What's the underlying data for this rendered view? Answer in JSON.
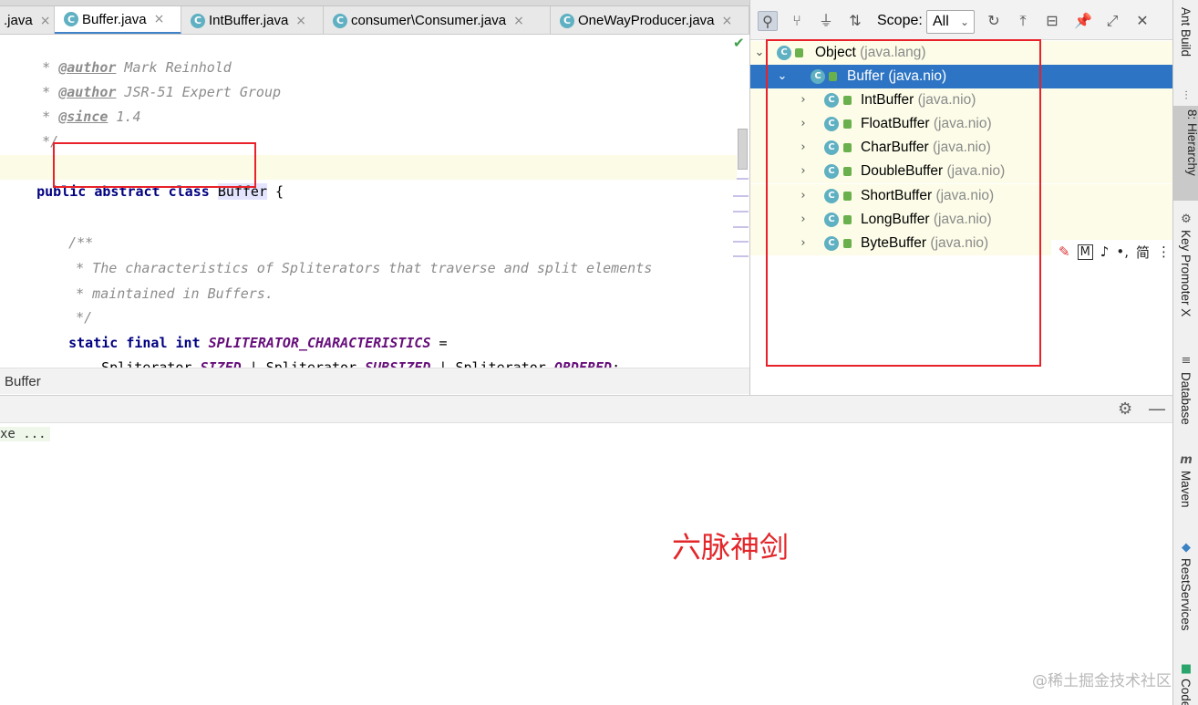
{
  "tabs": [
    {
      "label": ".java",
      "icon": "",
      "active": false
    },
    {
      "label": "Buffer.java",
      "icon": "c-abstract-class-icon",
      "active": true
    },
    {
      "label": "IntBuffer.java",
      "icon": "c-abstract-class-icon",
      "active": false
    },
    {
      "label": "consumer\\Consumer.java",
      "icon": "c-class-icon",
      "active": false
    },
    {
      "label": "OneWayProducer.java",
      "icon": "c-class-icon",
      "active": false
    }
  ],
  "tab_close_glyph": "×",
  "editor": {
    "lines": {
      "l1_star": "* ",
      "l1_tag": "@author",
      "l1_text": " Mark Reinhold",
      "l2_star": "* ",
      "l2_tag": "@author",
      "l2_text": " JSR-51 Expert Group",
      "l3_star": "* ",
      "l3_tag": "@since",
      "l3_text": " 1.4",
      "l4": "*/",
      "l5_public": "public ",
      "l5_abstract": "abstract class ",
      "l5_name": "Buffer",
      "l5_brace": " {",
      "l6": "/**",
      "l7": "* The characteristics of Spliterators that traverse and split elements",
      "l8": "* maintained in Buffers.",
      "l9": "*/",
      "l10_kw": "static final int ",
      "l10_const": "SPLITERATOR_CHARACTERISTICS",
      "l10_eq": " =",
      "l11_a": "Spliterator.",
      "l11_b": "SIZED",
      "l11_c": " | Spliterator.",
      "l11_d": "SUBSIZED",
      "l11_e": " | Spliterator.",
      "l11_f": "ORDERED",
      "l11_g": ";"
    },
    "breadcrumb": "Buffer"
  },
  "hierarchy": {
    "scope_label": "Scope:",
    "scope_value": "All",
    "toolbar_icons": [
      "subtypes-hierarchy-icon",
      "supertypes-hierarchy-icon",
      "class-hierarchy-icon",
      "sort-alpha-icon",
      "refresh-icon",
      "export-icon",
      "collapse-all-icon",
      "pin-icon",
      "open-in-window-icon",
      "close-icon"
    ],
    "tree": [
      {
        "name": "Object",
        "pkg": "(java.lang)",
        "level": 0,
        "expanded": true
      },
      {
        "name": "Buffer",
        "pkg": "(java.nio)",
        "level": 1,
        "expanded": true,
        "selected": true
      },
      {
        "name": "IntBuffer",
        "pkg": "(java.nio)",
        "level": 2
      },
      {
        "name": "FloatBuffer",
        "pkg": "(java.nio)",
        "level": 2
      },
      {
        "name": "CharBuffer",
        "pkg": "(java.nio)",
        "level": 2
      },
      {
        "name": "DoubleBuffer",
        "pkg": "(java.nio)",
        "level": 2
      },
      {
        "name": "ShortBuffer",
        "pkg": "(java.nio)",
        "level": 2
      },
      {
        "name": "LongBuffer",
        "pkg": "(java.nio)",
        "level": 2
      },
      {
        "name": "ByteBuffer",
        "pkg": "(java.nio)",
        "level": 2
      }
    ]
  },
  "bottom": {
    "run_text": "xe ...",
    "annotation": "六脉神剑",
    "watermark": "@稀土掘金技术社区"
  },
  "float_toolbar": {
    "glyphs": [
      "M",
      "♪",
      "•,",
      "简",
      "⋮"
    ]
  },
  "right_strip": {
    "tabs": [
      {
        "label": "Ant Build",
        "icon": "ant-icon"
      },
      {
        "label": "8: Hierarchy",
        "icon": "hierarchy-icon",
        "active": true
      },
      {
        "label": "Key Promoter X",
        "icon": "key-promoter-icon"
      },
      {
        "label": "Database",
        "icon": "database-icon"
      },
      {
        "label": "Maven",
        "icon": "maven-icon"
      },
      {
        "label": "RestServices",
        "icon": "rest-services-icon"
      },
      {
        "label": "Code",
        "icon": "code-icon"
      }
    ]
  },
  "colors": {
    "selection": "#2d74c4",
    "annotation_red": "#e3262a",
    "keyword": "#000080",
    "constant": "#660e7a",
    "comment": "#8c8c8c"
  }
}
